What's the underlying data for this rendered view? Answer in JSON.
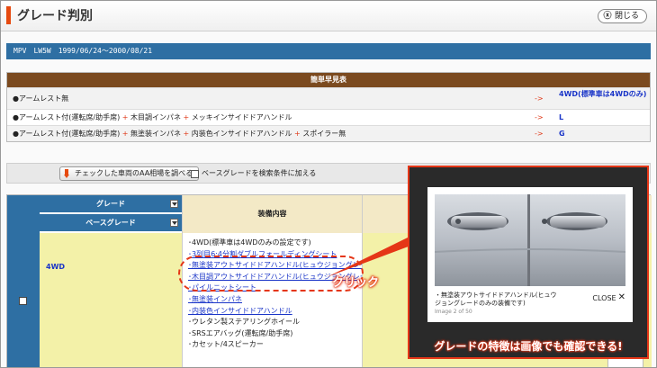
{
  "header": {
    "title": "グレード判別",
    "close_label": "閉じる"
  },
  "car": {
    "info": "MPV　LW5W　1999/06/24～2000/08/21"
  },
  "quick_table": {
    "title": "簡単早見表",
    "rows": [
      {
        "parts": [
          "●アームレスト無"
        ],
        "arrow": "->",
        "code": "4WD(標準車は4WDのみ)"
      },
      {
        "parts": [
          "●アームレスト付(運転席/助手席)",
          "木目調インパネ",
          "メッキインサイドドアハンドル"
        ],
        "arrow": "->",
        "code": "L"
      },
      {
        "parts": [
          "●アームレスト付(運転席/助手席)",
          "無塗装インパネ",
          "内装色インサイドドアハンドル",
          "スポイラー無"
        ],
        "arrow": "->",
        "code": "G"
      }
    ],
    "plus": "+"
  },
  "toolbar": {
    "check_aa_label": "チェックした車両のAA相場を調べる",
    "base_grade_label": "ベースグレードを検索条件に加える"
  },
  "grade_table": {
    "grade_header": "グレード",
    "base_grade_header": "ベースグレード",
    "equipment_header": "装備内容",
    "grade_value": "4WD",
    "equipment": [
      {
        "text": "･4WD(標準車は4WDのみの設定です)",
        "link": false
      },
      {
        "text": "･3列目6:4分割ダブルフォールディングシート",
        "link": true
      },
      {
        "text": "･無塗装アウトサイドドアハンドル(ヒュウジョングレードのみの装備です)",
        "link": true
      },
      {
        "text": "･木目調アウトサイドドアハンドル(ヒュウジョングレードのみの装備です)",
        "link": true
      },
      {
        "text": "･パイルニットシート",
        "link": true
      },
      {
        "text": "･無塗装インパネ",
        "link": true
      },
      {
        "text": "･内装色インサイドドアハンドル",
        "link": true
      },
      {
        "text": "･ウレタン製ステアリングホイール",
        "link": false
      },
      {
        "text": "･SRSエアバッグ(運転席/助手席)",
        "link": false
      },
      {
        "text": "･カセット/4スピーカー",
        "link": false
      }
    ]
  },
  "popup": {
    "caption": "・無塗装アウトサイドドアハンドル(ヒュウジョングレードのみの装備です)",
    "counter": "Image 2 of 50",
    "close_label": "CLOSE"
  },
  "annotations": {
    "click_label": "クリック",
    "promo": "グレードの特徴は画像でも確認できる!"
  },
  "fragment": "す",
  "colors": {
    "accent": "#e64a10",
    "blue": "#2e6fa3",
    "brown": "#7b4a1f",
    "highlight_red": "#e53617"
  }
}
